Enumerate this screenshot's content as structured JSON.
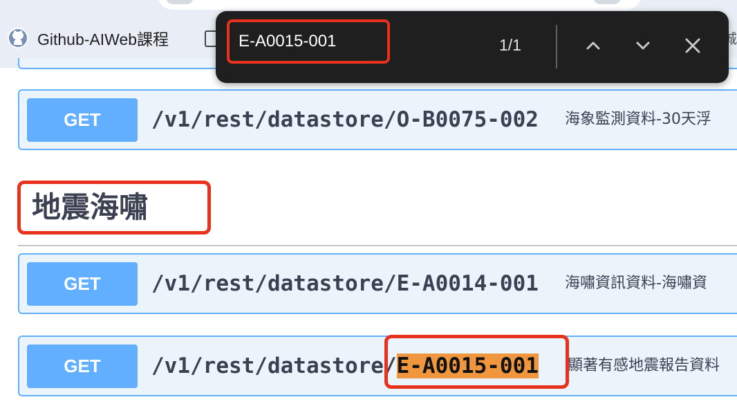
{
  "browser": {
    "bookmarks": [
      {
        "label": "Github-AIWeb課程",
        "icon": "github-icon"
      },
      {
        "label": "",
        "icon": "document-icon"
      }
    ],
    "bookmark_tail": "城"
  },
  "find_bar": {
    "query": "E-A0015-001",
    "match_count": "1/1",
    "buttons": {
      "previous": "chevron-up-icon",
      "next": "chevron-down-icon",
      "close": "close-icon"
    }
  },
  "page": {
    "operations": [
      {
        "method": "GET",
        "path": "/v1/rest/datastore/O-B0075-002",
        "description": "海象監測資料-30天浮"
      }
    ],
    "section": {
      "title": "地震海嘯",
      "operations": [
        {
          "method": "GET",
          "path": "/v1/rest/datastore/E-A0014-001",
          "description": "海嘯資訊資料-海嘯資"
        },
        {
          "method": "GET",
          "path_prefix": "/v1/rest/datastore/",
          "path_match": "E-A0015-001",
          "description": "顯著有感地震報告資料"
        }
      ]
    }
  },
  "colors": {
    "get_method": "#61affe",
    "row_background": "#ebf3fb",
    "find_highlight": "#f0963e",
    "annotation_red": "#e8321e",
    "findbar_background": "#1f1f1f"
  }
}
